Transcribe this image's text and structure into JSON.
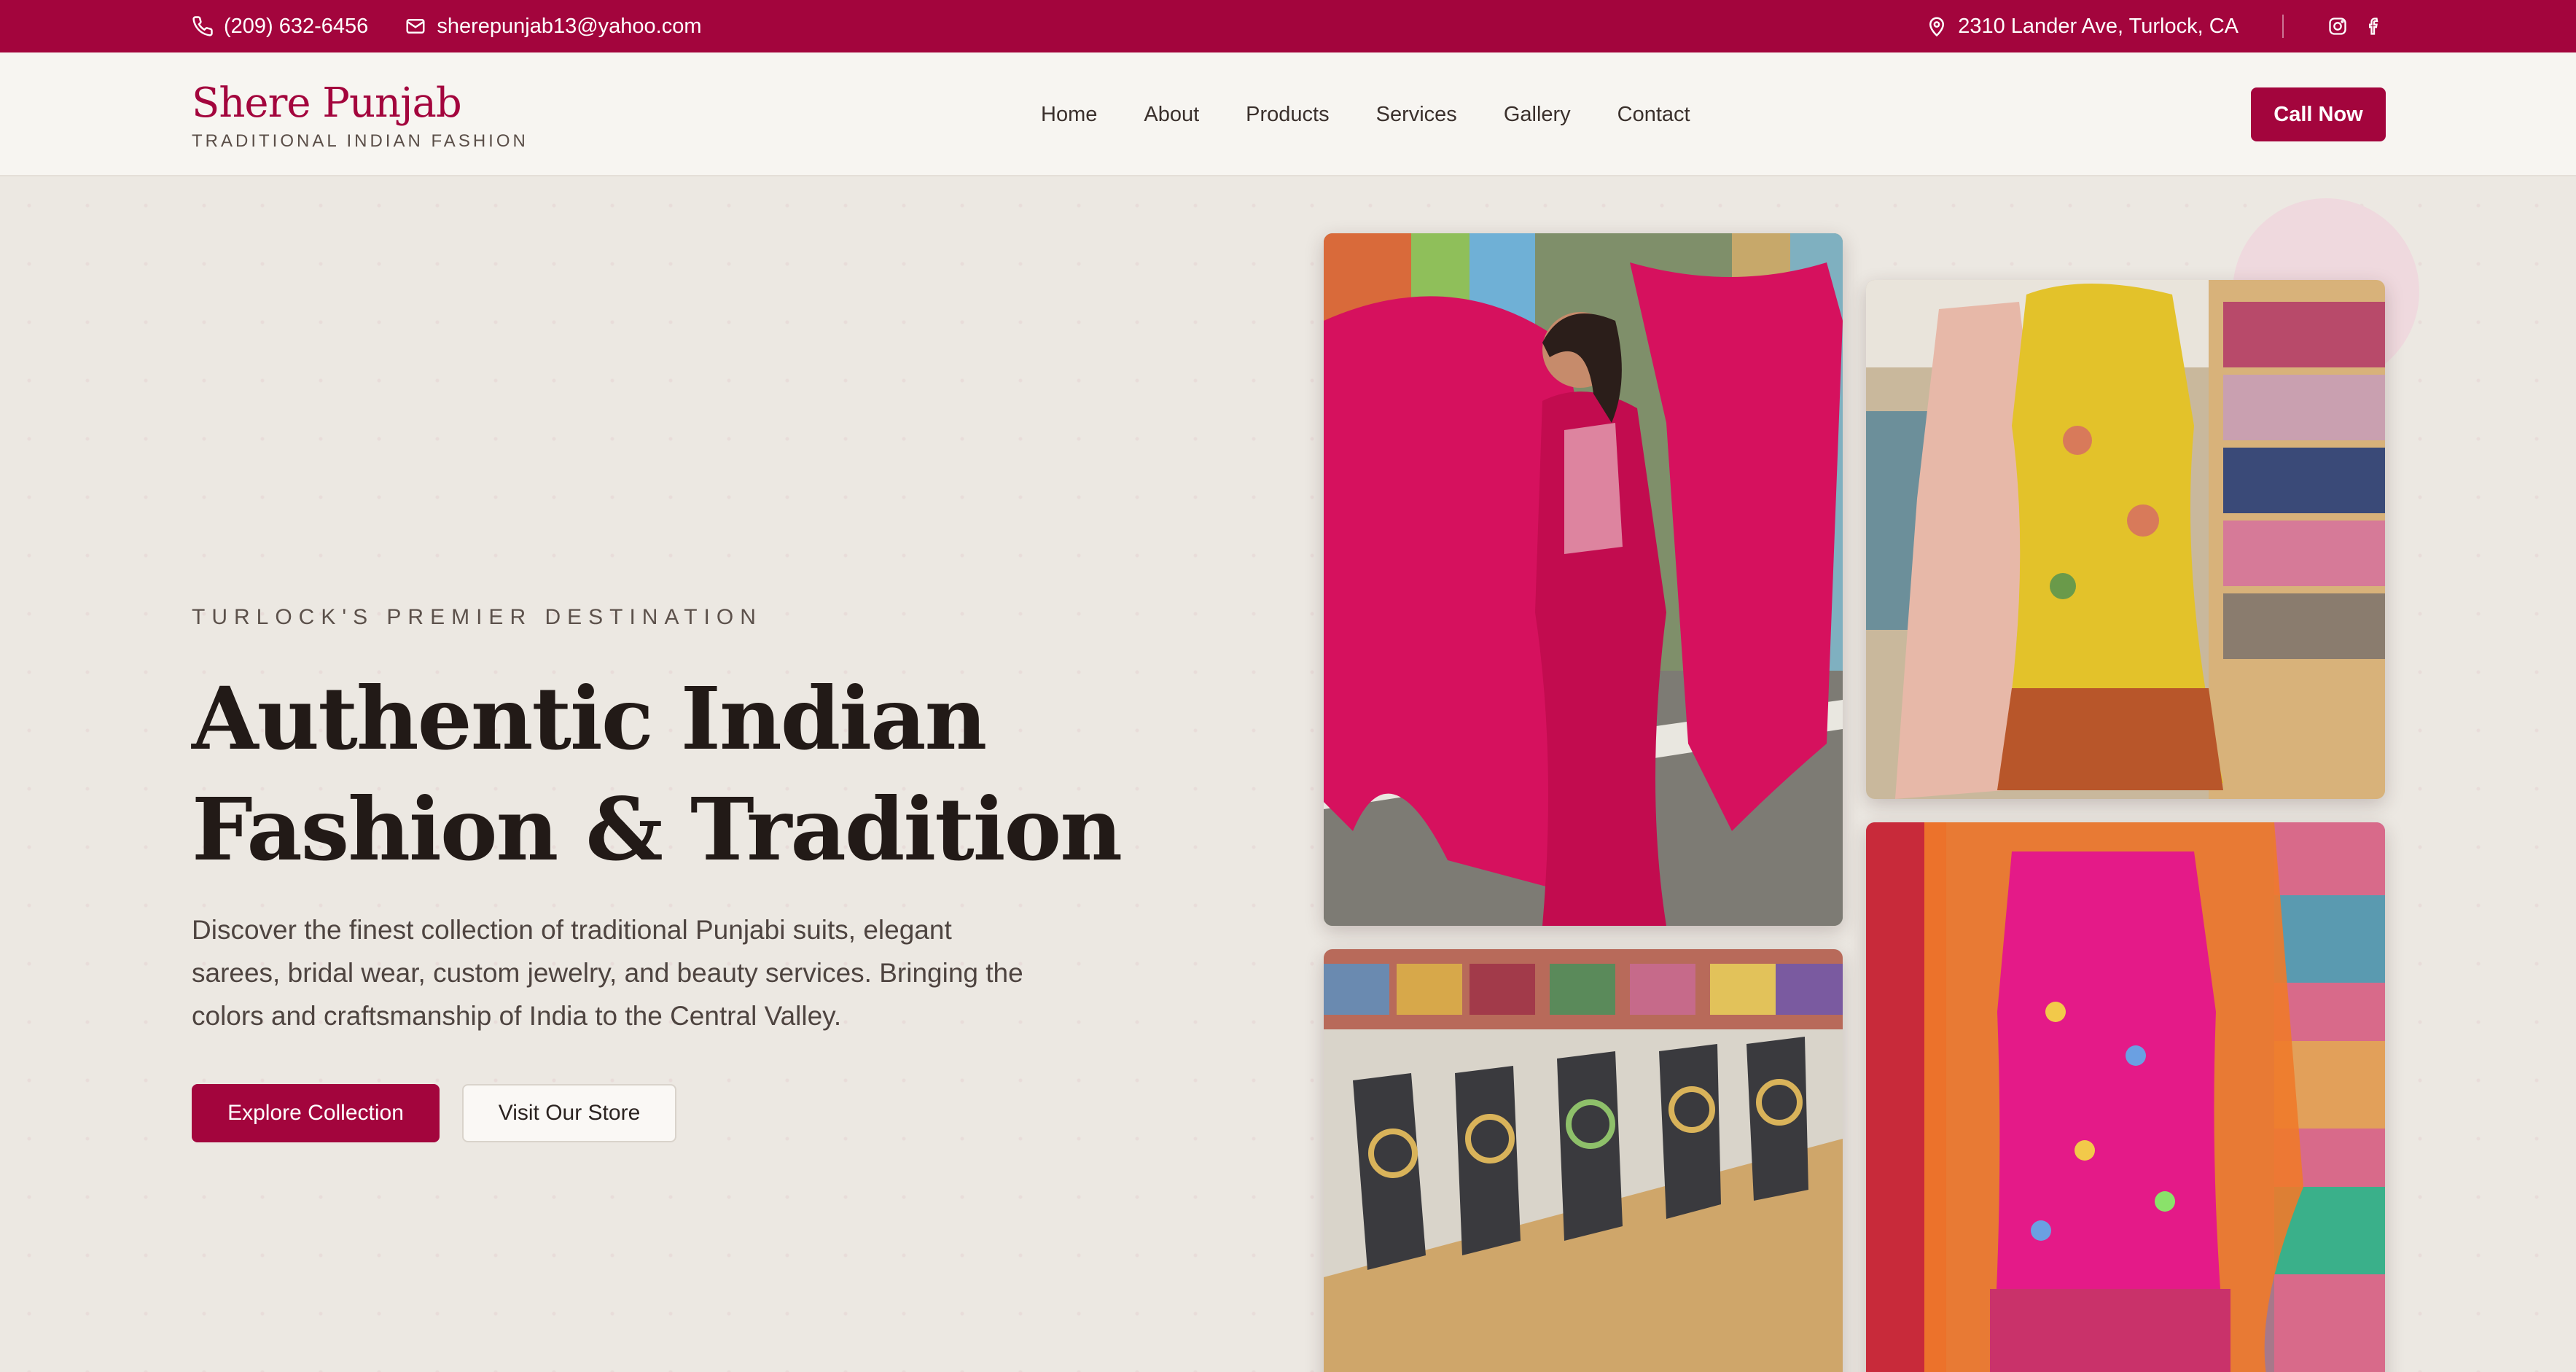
{
  "topbar": {
    "phone": "(209) 632-6456",
    "email": "sherepunjab13@yahoo.com",
    "address": "2310 Lander Ave, Turlock, CA",
    "icons": [
      "phone-icon",
      "mail-icon",
      "map-pin-icon",
      "instagram-icon",
      "facebook-icon"
    ]
  },
  "header": {
    "brand_name": "Shere Punjab",
    "brand_tagline": "TRADITIONAL INDIAN FASHION",
    "nav": [
      "Home",
      "About",
      "Products",
      "Services",
      "Gallery",
      "Contact"
    ],
    "cta": "Call Now"
  },
  "hero": {
    "eyebrow": "TURLOCK'S PREMIER DESTINATION",
    "headline_line1": "Authentic Indian",
    "headline_line2": "Fashion & Tradition",
    "lead": "Discover the finest collection of traditional Punjabi suits, elegant sarees, bridal wear, custom jewelry, and beauty services. Bringing the colors and craftsmanship of India to the Central Valley.",
    "primary_button": "Explore Collection",
    "secondary_button": "Visit Our Store"
  },
  "colors": {
    "brand": "#a3053d",
    "background": "#f7f5f1",
    "accent_soft": "#efd9de"
  }
}
